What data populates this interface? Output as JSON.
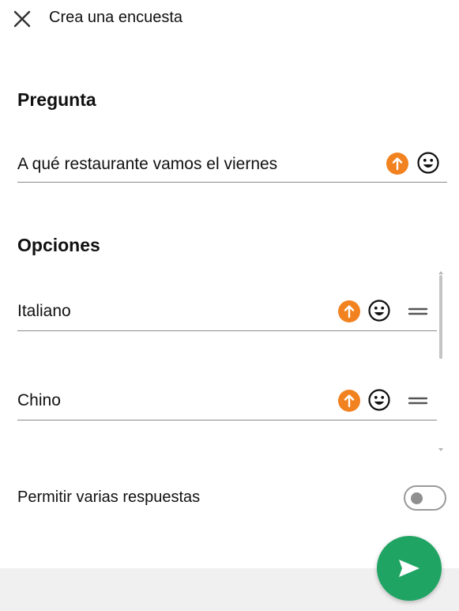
{
  "header": {
    "close_icon": "close-icon",
    "title": "Crea una encuesta"
  },
  "question": {
    "section_label": "Pregunta",
    "value": "A qué restaurante vamos el viernes"
  },
  "options": {
    "section_label": "Opciones",
    "items": [
      {
        "value": "Italiano"
      },
      {
        "value": "Chino"
      }
    ]
  },
  "multiple_answers": {
    "label": "Permitir varias respuestas",
    "enabled": false
  },
  "send": {
    "icon": "send-icon"
  },
  "colors": {
    "accent_orange": "#f28220",
    "fab_green": "#1fa463",
    "toggle_gray": "#8f8f8f"
  }
}
